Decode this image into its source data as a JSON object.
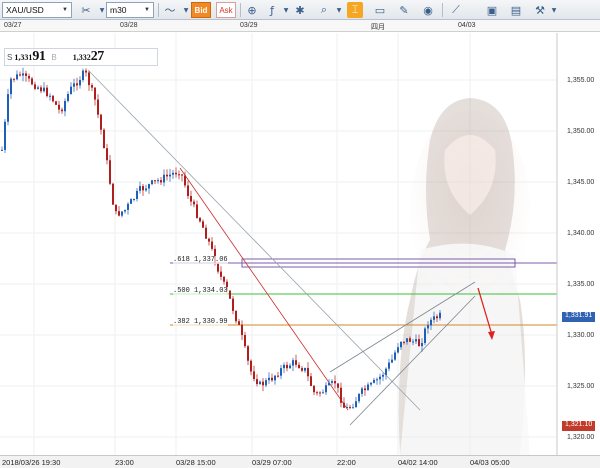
{
  "toolbar": {
    "symbol": "XAU/USD",
    "timeframe": "m30",
    "bid_label": "Bid",
    "ask_label": "Ask"
  },
  "top_axis": {
    "labels": [
      "03/27",
      "03/28",
      "03/29",
      "四月",
      "04/03"
    ]
  },
  "price_box": {
    "bid_prefix": "1,331",
    "bid_main": "91",
    "ask_prefix": "1,332",
    "ask_main": "27",
    "s_label": "S",
    "b_label": "B"
  },
  "right_axis": {
    "labels": [
      "1,355.00",
      "1,350.00",
      "1,345.00",
      "1,340.00",
      "1,335.00",
      "1,330.00",
      "1,325.00",
      "1,320.00"
    ],
    "current_price_tag": "1,331.91",
    "low_price_tag": "1,321.10"
  },
  "fib_levels": [
    {
      "label": ".618 1,337.06"
    },
    {
      "label": ".500 1,334.03"
    },
    {
      "label": ".382 1,330.99"
    }
  ],
  "bottom_axis": {
    "labels": [
      "2018/03/26 19:30",
      "23:00",
      "03/28 15:00",
      "03/29 07:00",
      "22:00",
      "04/02 14:00",
      "04/03 05:00"
    ]
  },
  "colors": {
    "bull_candle": "#1f5fb8",
    "bear_candle": "#b01e1e",
    "fib_618": "#7b5ea7",
    "fib_500": "#3bbf3b",
    "fib_382": "#d08a2a",
    "trend_red": "#cc2a2a",
    "current_tag": "#2f62b3",
    "low_tag": "#c23a2a"
  },
  "chart_data": {
    "type": "candlestick",
    "symbol": "XAU/USD",
    "timeframe": "m30",
    "ylim": [
      1320,
      1357
    ]
  }
}
